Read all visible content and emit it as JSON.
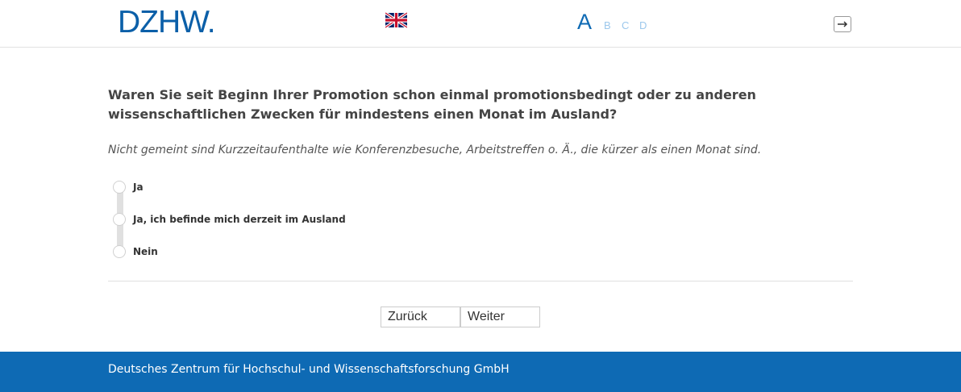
{
  "header": {
    "logo_text": "DZHW.",
    "language_flag_icon": "uk-flag-icon",
    "font_size": {
      "options": [
        {
          "label": "A",
          "active": true
        },
        {
          "label": "B",
          "active": false
        },
        {
          "label": "C",
          "active": false
        },
        {
          "label": "D",
          "active": false
        }
      ]
    },
    "logout_icon": "logout-arrow-icon"
  },
  "question": {
    "text": "Waren Sie seit Beginn Ihrer Promotion schon einmal promotionsbedingt oder zu anderen wissenschaftlichen Zwecken für mindestens einen Monat im Ausland?",
    "instruction": "Nicht gemeint sind Kurzzeitaufenthalte wie Konferenzbesuche, Arbeitstreffen o.  Ä., die kürzer als einen Monat sind."
  },
  "answers": [
    {
      "label": "Ja",
      "selected": false
    },
    {
      "label": "Ja, ich befinde mich derzeit im Ausland",
      "selected": false
    },
    {
      "label": "Nein",
      "selected": false
    }
  ],
  "navigation": {
    "back_label": "Zurück",
    "next_label": "Weiter"
  },
  "footer": {
    "text": "Deutsches Zentrum für Hochschul- und Wissenschaftsforschung GmbH"
  },
  "colors": {
    "brand_blue": "#0b5fa8",
    "footer_blue": "#0e6ab4",
    "font_size_inactive": "#9cc8ec"
  }
}
